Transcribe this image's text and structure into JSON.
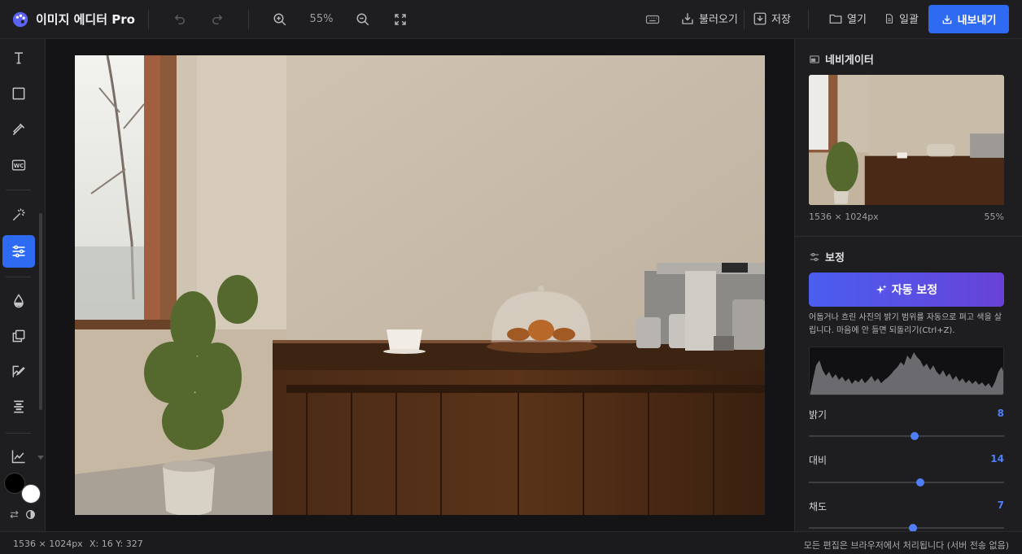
{
  "app": {
    "title": "이미지 에디터 Pro"
  },
  "toolbar": {
    "zoom": "55%",
    "load_label": "불러오기",
    "save_label": "저장",
    "open_label": "열기",
    "batch_label": "일괄",
    "export_label": "내보내기"
  },
  "left_tools": [
    {
      "icon": "text-icon"
    },
    {
      "icon": "rectangle-icon"
    },
    {
      "icon": "eyedropper-icon"
    },
    {
      "icon": "watermark-icon",
      "text": "WC"
    },
    {
      "icon": "magic-wand-icon"
    },
    {
      "icon": "adjust-sliders-icon",
      "active": true
    },
    {
      "icon": "drop-icon"
    },
    {
      "icon": "layers-icon"
    },
    {
      "icon": "image-edit-icon"
    },
    {
      "icon": "align-icon"
    },
    {
      "icon": "chart-line-icon"
    }
  ],
  "navigator": {
    "title": "네비게이터",
    "dimensions": "1536 × 1024px",
    "zoom": "55%"
  },
  "adjust": {
    "title": "보정",
    "auto_button": "자동 보정",
    "description": "어둡거나 흐린 사진의 밝기 범위를 자동으로 펴고 색을 살립니다. 마음에 안 들면 되돌리기(Ctrl+Z).",
    "sliders": [
      {
        "label": "밝기",
        "value": "8",
        "level": 0.54
      },
      {
        "label": "대비",
        "value": "14",
        "level": 0.57
      },
      {
        "label": "채도",
        "value": "7",
        "level": 0.535
      }
    ]
  },
  "status": {
    "dimensions": "1536 × 1024px",
    "cursor": "X: 16 Y: 327",
    "notice": "모든 편집은 브라우저에서 처리됩니다 (서버 전송 없음)"
  },
  "colors": {
    "accent": "#2f6bf2",
    "slider": "#4f7ef7",
    "foreground": "#000000",
    "background": "#ffffff"
  }
}
